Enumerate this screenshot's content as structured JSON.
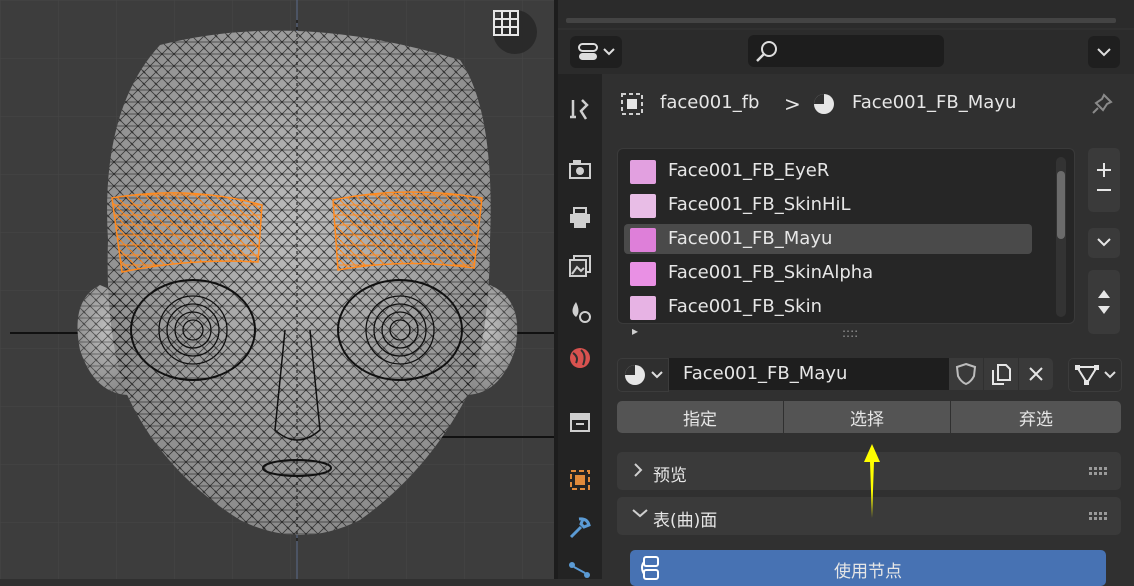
{
  "viewport": {
    "grid_icon": "grid-icon"
  },
  "properties": {
    "header": {
      "editor_icon": "properties-editor-icon",
      "search_placeholder": ""
    },
    "tabs": [
      {
        "icon": "tool-icon"
      },
      {
        "icon": "render-icon"
      },
      {
        "icon": "output-icon"
      },
      {
        "icon": "view-layer-icon"
      },
      {
        "icon": "scene-icon"
      },
      {
        "icon": "world-icon"
      },
      {
        "icon": "collection-icon"
      },
      {
        "icon": "object-icon"
      },
      {
        "icon": "modifier-icon"
      },
      {
        "icon": "particles-icon"
      }
    ],
    "breadcrumb": {
      "object": "face001_fb",
      "separator": ">",
      "material": "Face001_FB_Mayu"
    },
    "material_slots": [
      {
        "name": "Face001_FB_EyeR",
        "color": "#e2a0e0"
      },
      {
        "name": "Face001_FB_SkinHiL",
        "color": "#e8bde6"
      },
      {
        "name": "Face001_FB_Mayu",
        "color": "#de7fd9",
        "active": true
      },
      {
        "name": "Face001_FB_SkinAlpha",
        "color": "#e990e4"
      },
      {
        "name": "Face001_FB_Skin",
        "color": "#e7b3e4"
      }
    ],
    "list_footer": {
      "expand": "▸",
      "grip": "::::"
    },
    "material_name": "Face001_FB_Mayu",
    "actions": {
      "assign": "指定",
      "select": "选择",
      "deselect": "弃选"
    },
    "panels": {
      "preview": "预览",
      "surface": "表(曲)面"
    },
    "use_nodes": "使用节点",
    "accent_color": "#4772b3",
    "annotation_arrow_color": "#ffff00"
  }
}
